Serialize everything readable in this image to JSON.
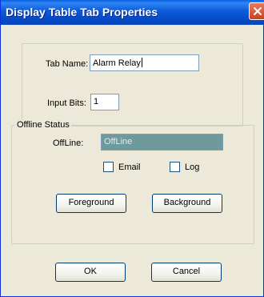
{
  "window": {
    "title": "Display Table Tab Properties"
  },
  "tab_name": {
    "label": "Tab Name:",
    "value": "Alarm Relay"
  },
  "input_bits": {
    "label": "Input Bits:",
    "value": "1"
  },
  "offline_status": {
    "legend": "Offline Status",
    "offline_label": "OffLine:",
    "offline_value": "OffLine",
    "email_label": "Email",
    "email_checked": false,
    "log_label": "Log",
    "log_checked": false,
    "foreground_label": "Foreground",
    "background_label": "Background"
  },
  "buttons": {
    "ok_label": "OK",
    "cancel_label": "Cancel"
  },
  "colors": {
    "titlebar": "#0a5fe0",
    "dialog_bg": "#ece9d8",
    "offline_field_bg": "#6e9a9e"
  },
  "icons": {
    "close": "close-icon"
  }
}
